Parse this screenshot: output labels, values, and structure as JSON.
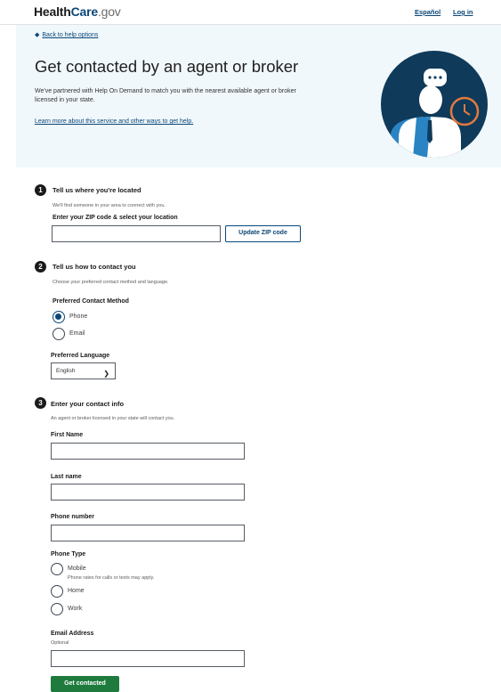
{
  "header": {
    "logo_health": "Health",
    "logo_care": "Care",
    "logo_gov": ".gov",
    "espanol": "Español",
    "login": "Log in"
  },
  "hero": {
    "back_link": "Back to help options",
    "title": "Get contacted by an agent or broker",
    "intro": "We've partnered with Help On Demand to match you with the nearest available agent or broker licensed in your state.",
    "learn_more": "Learn more about this service and other ways to get help."
  },
  "step1": {
    "number": "1",
    "title": "Tell us where you're located",
    "hint": "We'll find someone in your area to connect with you.",
    "zip_label": "Enter your ZIP code & select your location",
    "zip_value": "",
    "update_button": "Update ZIP code"
  },
  "step2": {
    "number": "2",
    "title": "Tell us how to contact you",
    "hint": "Choose your preferred contact method and language.",
    "method_label": "Preferred Contact Method",
    "methods": [
      {
        "label": "Phone",
        "checked": true
      },
      {
        "label": "Email",
        "checked": false
      }
    ],
    "language_label": "Preferred Language",
    "language_value": "English"
  },
  "step3": {
    "number": "3",
    "title": "Enter your contact info",
    "hint": "An agent or broker licensed in your state will contact you.",
    "first_name_label": "First Name",
    "last_name_label": "Last name",
    "phone_label": "Phone number",
    "phone_type_label": "Phone Type",
    "phone_types": [
      {
        "label": "Mobile",
        "note": "Phone rates for calls or texts may apply."
      },
      {
        "label": "Home",
        "note": ""
      },
      {
        "label": "Work",
        "note": ""
      }
    ],
    "email_label": "Email Address",
    "email_optional": "Optional",
    "submit": "Get contacted"
  },
  "colors": {
    "brand_blue": "#0b4778",
    "hero_bg": "#f1f8fc",
    "submit_green": "#1e7b3d",
    "illus_navy": "#0f3a5a",
    "clock_orange": "#e27a3f"
  },
  "icons": [
    "back-arrow-icon",
    "agent-illustration",
    "speech-bubble-icon",
    "clock-icon",
    "chevron-down-icon"
  ]
}
